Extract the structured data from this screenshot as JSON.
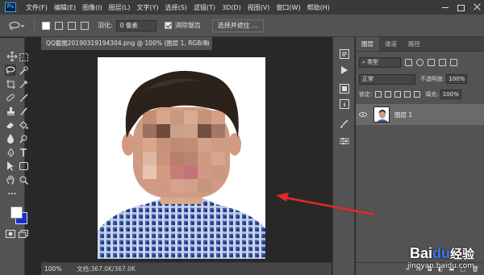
{
  "app": {
    "logo": "Ps"
  },
  "menu": [
    "文件(F)",
    "编辑(E)",
    "图像(I)",
    "图层(L)",
    "文字(Y)",
    "选择(S)",
    "滤镜(T)",
    "3D(D)",
    "视图(V)",
    "窗口(W)",
    "帮助(H)"
  ],
  "options_bar": {
    "feather_label": "羽化:",
    "feather_value": "0 像素",
    "antialias_label": "消除锯齿",
    "select_mask_label": "选择并遮住 ..."
  },
  "document": {
    "tab_title": "QQ截图20190319194304.png @ 100% (图层 1, RGB/8)",
    "close_label": "×",
    "zoom": "100%",
    "doc_info": "文档:367.0K/367.0K"
  },
  "layers_panel": {
    "tabs": [
      "图层",
      "通道",
      "路径"
    ],
    "kind_label": "类型",
    "blend_mode": "正常",
    "opacity_label": "不透明度:",
    "opacity_value": "100%",
    "lock_label": "锁定:",
    "fill_label": "填充:",
    "fill_value": "100%",
    "layer_name": "图层 1",
    "bottom_fx": "fx"
  },
  "watermark": {
    "logo_part1": "Bai",
    "logo_part2": "du",
    "logo_part3": "经验",
    "url": "jingyan.baidu.com"
  },
  "colors": {
    "foreground": "#ffffff",
    "background": "#1a2bd8",
    "annotation_arrow": "#e02a2a"
  }
}
